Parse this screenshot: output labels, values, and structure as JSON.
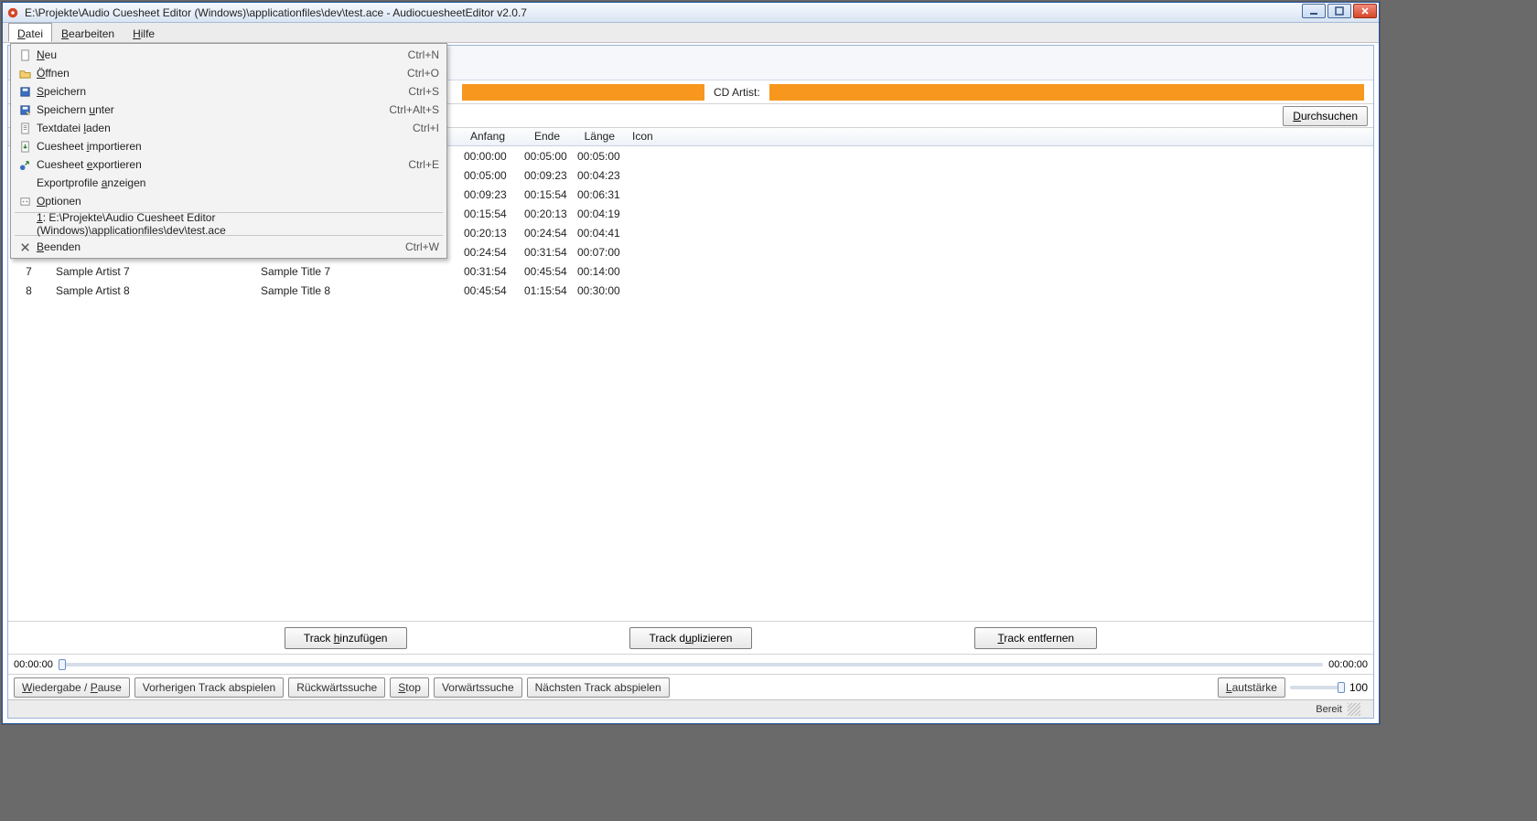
{
  "title": "E:\\Projekte\\Audio Cuesheet Editor (Windows)\\applicationfiles\\dev\\test.ace - AudiocuesheetEditor v2.0.7",
  "menubar": {
    "datei": "Datei",
    "bearbeiten": "Bearbeiten",
    "hilfe": "Hilfe"
  },
  "dropdown": {
    "neu": "Neu",
    "neu_sc": "Ctrl+N",
    "oeffnen": "Öffnen",
    "oeffnen_sc": "Ctrl+O",
    "speichern": "Speichern",
    "speichern_sc": "Ctrl+S",
    "speichern_unter": "Speichern unter",
    "speichern_unter_sc": "Ctrl+Alt+S",
    "textdatei": "Textdatei laden",
    "textdatei_sc": "Ctrl+I",
    "import": "Cuesheet importieren",
    "export": "Cuesheet exportieren",
    "export_sc": "Ctrl+E",
    "exportprofile": "Exportprofile anzeigen",
    "optionen": "Optionen",
    "recent": "1: E:\\Projekte\\Audio Cuesheet Editor (Windows)\\applicationfiles\\dev\\test.ace",
    "beenden": "Beenden",
    "beenden_sc": "Ctrl+W"
  },
  "cd_row": {
    "label": "CD Artist:",
    "browse": "Durchsuchen"
  },
  "columns": {
    "anfang": "Anfang",
    "ende": "Ende",
    "laenge": "Länge",
    "icon": "Icon"
  },
  "tracks": [
    {
      "nr": "",
      "artist": "",
      "title": "",
      "anfang": "00:00:00",
      "ende": "00:05:00",
      "laenge": "00:05:00"
    },
    {
      "nr": "",
      "artist": "",
      "title": "",
      "anfang": "00:05:00",
      "ende": "00:09:23",
      "laenge": "00:04:23"
    },
    {
      "nr": "",
      "artist": "",
      "title": "",
      "anfang": "00:09:23",
      "ende": "00:15:54",
      "laenge": "00:06:31"
    },
    {
      "nr": "",
      "artist": "",
      "title": "",
      "anfang": "00:15:54",
      "ende": "00:20:13",
      "laenge": "00:04:19"
    },
    {
      "nr": "",
      "artist": "",
      "title": "",
      "anfang": "00:20:13",
      "ende": "00:24:54",
      "laenge": "00:04:41"
    },
    {
      "nr": "",
      "artist": "",
      "title": "",
      "anfang": "00:24:54",
      "ende": "00:31:54",
      "laenge": "00:07:00"
    },
    {
      "nr": "7",
      "artist": "Sample Artist 7",
      "title": "Sample Title 7",
      "anfang": "00:31:54",
      "ende": "00:45:54",
      "laenge": "00:14:00"
    },
    {
      "nr": "8",
      "artist": "Sample Artist 8",
      "title": "Sample Title 8",
      "anfang": "00:45:54",
      "ende": "01:15:54",
      "laenge": "00:30:00"
    }
  ],
  "track_buttons": {
    "add": "Track hinzufügen",
    "dup": "Track duplizieren",
    "remove": "Track entfernen"
  },
  "slider": {
    "left": "00:00:00",
    "right": "00:00:00"
  },
  "playback": {
    "play_pause": "Wiedergabe / Pause",
    "prev": "Vorherigen Track abspielen",
    "rew": "Rückwärtssuche",
    "stop": "Stop",
    "fwd": "Vorwärtssuche",
    "next": "Nächsten Track abspielen",
    "volume_label": "Lautstärke",
    "volume_value": "100"
  },
  "status": "Bereit"
}
